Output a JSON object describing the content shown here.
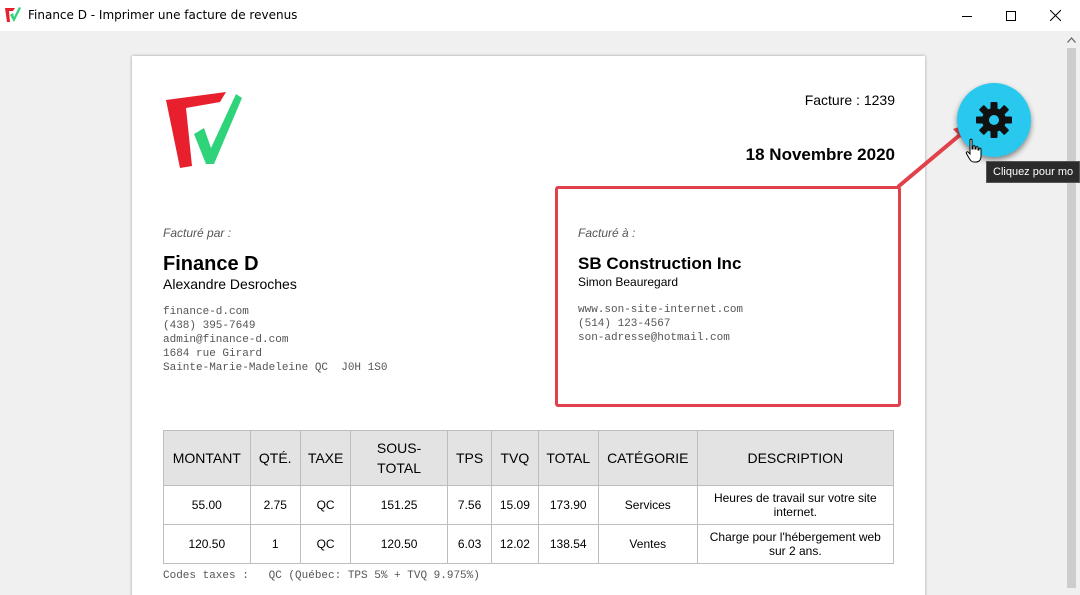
{
  "window": {
    "title": "Finance D - Imprimer une facture de revenus",
    "icon": "finance-d-logo-icon",
    "controls": {
      "minimize_icon": "minimize-icon",
      "maximize_icon": "maximize-icon",
      "close_icon": "close-icon"
    }
  },
  "invoice": {
    "number_label": "Facture :",
    "number": "1239",
    "date": "18 Novembre 2020",
    "billed_by": {
      "label": "Facturé par :",
      "company": "Finance D",
      "contact": "Alexandre Desroches",
      "details": "finance-d.com\n(438) 395-7649\nadmin@finance-d.com\n1684 rue Girard\nSainte-Marie-Madeleine QC  J0H 1S0"
    },
    "billed_to": {
      "label": "Facturé à :",
      "company": "SB Construction Inc",
      "contact": "Simon Beauregard",
      "details": "www.son-site-internet.com\n(514) 123-4567\nson-adresse@hotmail.com"
    },
    "table": {
      "headers": [
        "MONTANT",
        "QTÉ.",
        "TAXE",
        "SOUS-TOTAL",
        "TPS",
        "TVQ",
        "TOTAL",
        "CATÉGORIE",
        "DESCRIPTION"
      ],
      "rows": [
        [
          "55.00",
          "2.75",
          "QC",
          "151.25",
          "7.56",
          "15.09",
          "173.90",
          "Services",
          "Heures de travail sur votre site internet."
        ],
        [
          "120.50",
          "1",
          "QC",
          "120.50",
          "6.03",
          "12.02",
          "138.54",
          "Ventes",
          "Charge pour l'hébergement web sur 2 ans."
        ]
      ]
    },
    "tax_note": "Codes taxes :   QC (Québec: TPS 5% + TVQ 9.975%)"
  },
  "settings_button": {
    "icon": "gear-icon",
    "tooltip": "Cliquez pour mo"
  },
  "colors": {
    "highlight": "#e0414a",
    "gear_button": "#29c9ef",
    "logo_red": "#e8202e",
    "logo_green": "#2fd47a"
  }
}
